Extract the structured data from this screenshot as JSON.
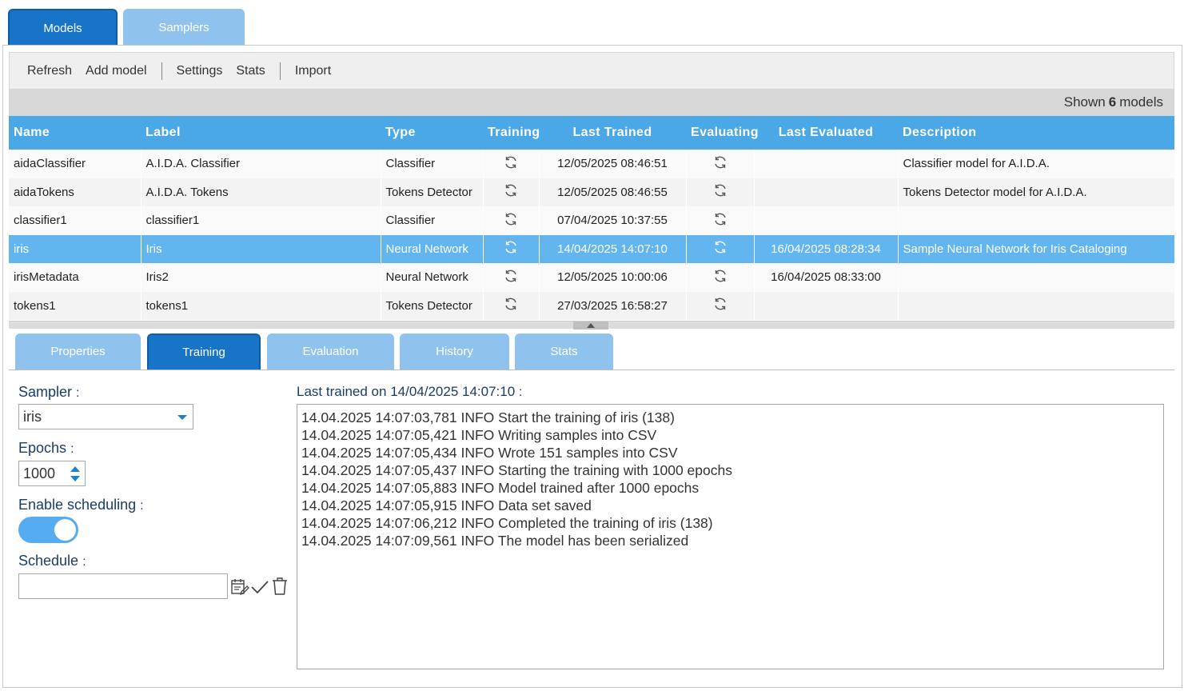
{
  "top_tabs": {
    "models": "Models",
    "samplers": "Samplers"
  },
  "toolbar": {
    "refresh": "Refresh",
    "add_model": "Add model",
    "settings": "Settings",
    "stats": "Stats",
    "import": "Import"
  },
  "count": {
    "prefix": "Shown",
    "value": "6",
    "suffix": "models"
  },
  "table": {
    "headers": {
      "name": "Name",
      "label": "Label",
      "type": "Type",
      "training": "Training",
      "last_trained": "Last Trained",
      "evaluating": "Evaluating",
      "last_evaluated": "Last Evaluated",
      "description": "Description"
    },
    "rows": [
      {
        "name": "aidaClassifier",
        "label": "A.I.D.A. Classifier",
        "type": "Classifier",
        "last_trained": "12/05/2025 08:46:51",
        "last_evaluated": "",
        "description": "Classifier model for A.I.D.A."
      },
      {
        "name": "aidaTokens",
        "label": "A.I.D.A. Tokens",
        "type": "Tokens Detector",
        "last_trained": "12/05/2025 08:46:55",
        "last_evaluated": "",
        "description": "Tokens Detector model for A.I.D.A."
      },
      {
        "name": "classifier1",
        "label": "classifier1",
        "type": "Classifier",
        "last_trained": "07/04/2025 10:37:55",
        "last_evaluated": "",
        "description": ""
      },
      {
        "name": "iris",
        "label": "Iris",
        "type": "Neural Network",
        "last_trained": "14/04/2025 14:07:10",
        "last_evaluated": "16/04/2025 08:28:34",
        "description": "Sample Neural Network for Iris Cataloging"
      },
      {
        "name": "irisMetadata",
        "label": "Iris2",
        "type": "Neural Network",
        "last_trained": "12/05/2025 10:00:06",
        "last_evaluated": "16/04/2025 08:33:00",
        "description": ""
      },
      {
        "name": "tokens1",
        "label": "tokens1",
        "type": "Tokens Detector",
        "last_trained": "27/03/2025 16:58:27",
        "last_evaluated": "",
        "description": ""
      }
    ],
    "selected_index": 3
  },
  "sub_tabs": {
    "properties": "Properties",
    "training": "Training",
    "evaluation": "Evaluation",
    "history": "History",
    "stats": "Stats"
  },
  "form": {
    "sampler_label": "Sampler",
    "sampler_value": "iris",
    "epochs_label": "Epochs",
    "epochs_value": "1000",
    "scheduling_label": "Enable scheduling",
    "scheduling_enabled": true,
    "schedule_label": "Schedule",
    "schedule_value": "",
    "colon": ":"
  },
  "log": {
    "title": "Last trained on 14/04/2025 14:07:10",
    "lines": [
      "14.04.2025 14:07:03,781 INFO Start the training of iris (138)",
      "14.04.2025 14:07:05,421 INFO Writing samples into CSV",
      "14.04.2025 14:07:05,434 INFO Wrote 151 samples into CSV",
      "14.04.2025 14:07:05,437 INFO Starting the training with 1000 epochs",
      "14.04.2025 14:07:05,883 INFO Model trained after 1000 epochs",
      "14.04.2025 14:07:05,915 INFO Data set saved",
      "14.04.2025 14:07:06,212 INFO Completed the training of iris (138)",
      "14.04.2025 14:07:09,561 INFO The model has been serialized"
    ]
  },
  "icons": {
    "refresh": "refresh-icon",
    "calendar_edit": "calendar-edit-icon",
    "check": "check-icon",
    "trash": "trash-icon"
  },
  "colors": {
    "header_blue": "#4aa8e6",
    "selected_row": "#62b5ee",
    "active_tab": "#1874c6",
    "inactive_tab": "#8fc3ee",
    "toggle_on": "#55acf0",
    "form_label": "#1a3d66"
  }
}
